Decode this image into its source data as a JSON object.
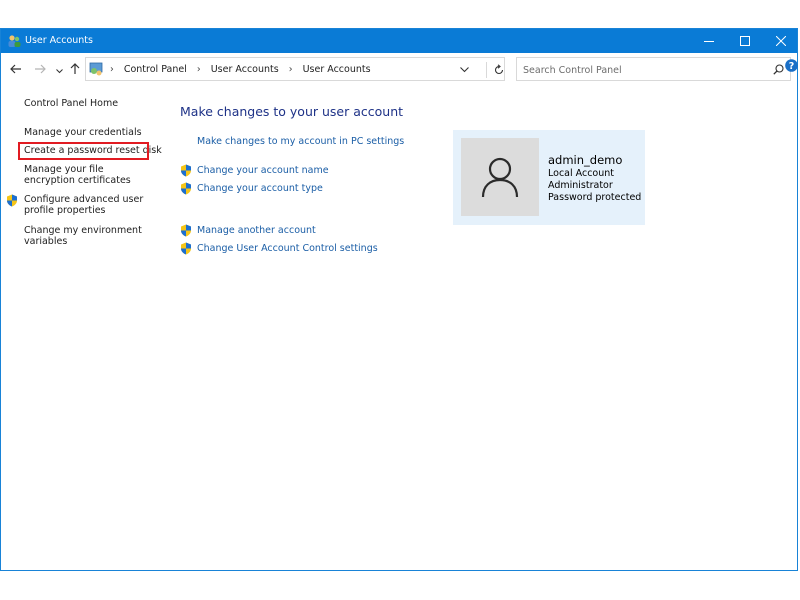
{
  "window": {
    "title": "User Accounts",
    "accent": "#0a7bd6"
  },
  "address": {
    "crumbs": [
      "Control Panel",
      "User Accounts",
      "User Accounts"
    ]
  },
  "search": {
    "placeholder": "Search Control Panel"
  },
  "sidebar": {
    "home": "Control Panel Home",
    "items": [
      {
        "label": "Manage your credentials"
      },
      {
        "label": "Create a password reset disk"
      },
      {
        "label": "Manage your file encryption certificates"
      },
      {
        "label": "Configure advanced user profile properties"
      },
      {
        "label": "Change my environment variables"
      }
    ]
  },
  "main": {
    "title": "Make changes to your user account",
    "links": [
      "Make changes to my account in PC settings",
      "Change your account name",
      "Change your account type",
      "Manage another account",
      "Change User Account Control settings"
    ]
  },
  "account": {
    "name": "admin_demo",
    "type": "Local Account",
    "role": "Administrator",
    "status": "Password protected"
  },
  "colors": {
    "highlight": "#e11b22",
    "link": "#1b5ea6",
    "heading": "#1e3287",
    "card": "#e5f1fb"
  },
  "icons": [
    "user-accounts-icon",
    "minimize-icon",
    "maximize-icon",
    "close-icon",
    "back-arrow-icon",
    "forward-arrow-icon",
    "recent-chevron-icon",
    "up-arrow-icon",
    "chevron-down-icon",
    "refresh-icon",
    "search-icon",
    "help-icon",
    "shield-icon",
    "user-avatar-icon"
  ]
}
